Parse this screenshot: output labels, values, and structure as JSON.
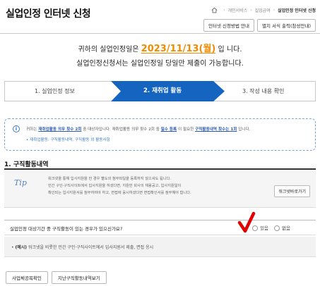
{
  "page": {
    "title": "실업인정 인터넷 신청"
  },
  "breadcrumb": {
    "items": [
      "개인서비스",
      "실업급여"
    ],
    "current": "실업인정 인터넷 신청"
  },
  "top_buttons": {
    "guide": "인터넷 신청방법 안내",
    "print_form": "별지 서식 출력(참성안내)"
  },
  "notice": {
    "prefix": "귀하의 실업인정일은",
    "date": "2023/11/13(월)",
    "suffix": "입 니다.",
    "line2": "실업인정신청서는 실업인정일 당일만 제출이 가능합니다."
  },
  "steps": [
    {
      "label": "1. 실업인정 정보",
      "active": false
    },
    {
      "label": "2. 재취업 활동",
      "active": true
    },
    {
      "label": "3. 작성 내용 확인",
      "active": false
    }
  ],
  "info_box": {
    "line1_a": "귀하는",
    "line1_highlight1": "재취업활동 의무 횟수 2회",
    "line1_b": "중 대상자입니다. 재취업활동 의무 횟수 2회 중",
    "line1_highlight2": "필수 등록",
    "line1_c": "이 필요한",
    "line1_highlight3": "구직활동내역 횟수는 1회",
    "line1_d": "입니다.",
    "line2": "• 재취업활동: 구직활동내역, 구직활동 외 활동사항"
  },
  "section": {
    "title": "1. 구직활동내역"
  },
  "tip": {
    "icon_text": "Tip",
    "lines": [
      "워크넷을 통해 입사지원을 한 경우 별도의 첨부파일을 등록하지 않으셔도 됩니다.",
      "민간 구인·구직사이트에서 입사지원을 하셨다면, 지원한 회사의 채용공고, 입사지원일이",
      "확인되는 입사지원서를 첨부하여야 하고, 면접에 응시하셨다면 면접확인서를 첨부해야 합니다."
    ],
    "button": "워크넷바로가기"
  },
  "question": {
    "text": "실업인정 대상기간 중 구직활동이 있는 경우가 있으신가요?",
    "options": [
      "있음",
      "없음"
    ],
    "selected": "있음"
  },
  "example": {
    "label": "(예시)",
    "text": "워크넷을 비롯한 민간 구인·구직사이트에서 입사지원서 제출, 면접 응시"
  },
  "bottom_buttons": {
    "business_check": "사업체공목확인",
    "past_activity": "지난구직활동내역보기"
  },
  "colors": {
    "accent_blue": "#1565c0",
    "date_orange": "#f08a00",
    "check_red": "#e00000"
  }
}
